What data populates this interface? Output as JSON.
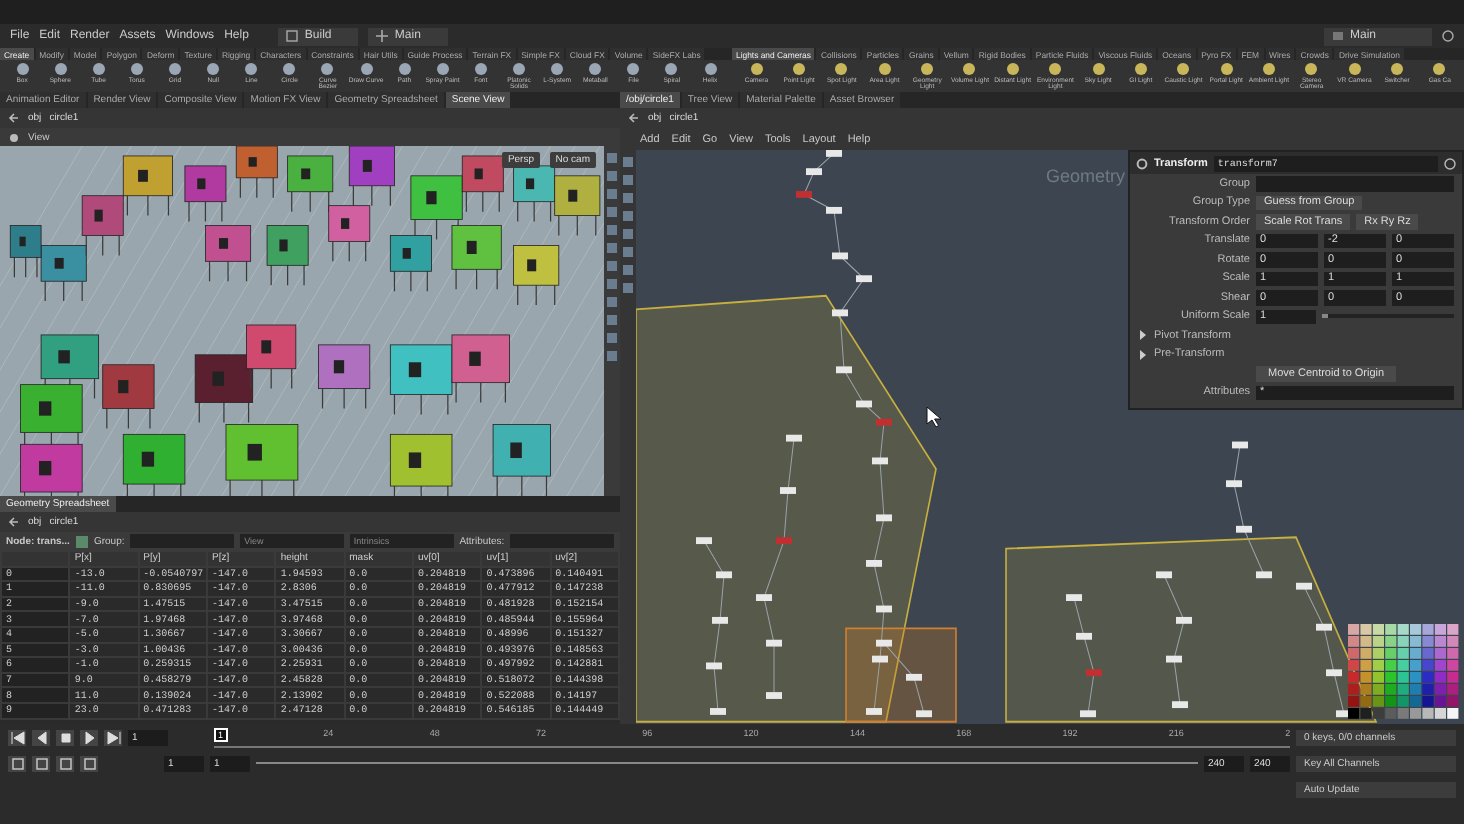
{
  "menubar": {
    "menus": [
      "File",
      "Edit",
      "Render",
      "Assets",
      "Windows",
      "Help"
    ],
    "desktop": "Build",
    "context": "Main",
    "right_context": "Main"
  },
  "shelves": [
    {
      "tabs": [
        {
          "label": "Create",
          "selected": true
        },
        {
          "label": "Modify",
          "selected": false
        },
        {
          "label": "Model",
          "selected": false
        },
        {
          "label": "Polygon",
          "selected": false
        },
        {
          "label": "Deform",
          "selected": false
        },
        {
          "label": "Texture",
          "selected": false
        },
        {
          "label": "Rigging",
          "selected": false
        },
        {
          "label": "Characters",
          "selected": false
        },
        {
          "label": "Constraints",
          "selected": false
        },
        {
          "label": "Hair Utils",
          "selected": false
        },
        {
          "label": "Guide Process",
          "selected": false
        },
        {
          "label": "Terrain FX",
          "selected": false
        },
        {
          "label": "Simple FX",
          "selected": false
        },
        {
          "label": "Cloud FX",
          "selected": false
        },
        {
          "label": "Volume",
          "selected": false
        },
        {
          "label": "SideFX Labs",
          "selected": false
        }
      ],
      "tools": [
        "Box",
        "Sphere",
        "Tube",
        "Torus",
        "Grid",
        "Null",
        "Line",
        "Circle",
        "Curve Bezier",
        "Draw Curve",
        "Path",
        "Spray Paint",
        "Font",
        "Platonic Solids",
        "L-System",
        "Metaball",
        "File",
        "Spiral",
        "Helix"
      ]
    },
    {
      "tabs": [
        {
          "label": "Lights and Cameras",
          "selected": true
        },
        {
          "label": "Collisions",
          "selected": false
        },
        {
          "label": "Particles",
          "selected": false
        },
        {
          "label": "Grains",
          "selected": false
        },
        {
          "label": "Vellum",
          "selected": false
        },
        {
          "label": "Rigid Bodies",
          "selected": false
        },
        {
          "label": "Particle Fluids",
          "selected": false
        },
        {
          "label": "Viscous Fluids",
          "selected": false
        },
        {
          "label": "Oceans",
          "selected": false
        },
        {
          "label": "Pyro FX",
          "selected": false
        },
        {
          "label": "FEM",
          "selected": false
        },
        {
          "label": "Wires",
          "selected": false
        },
        {
          "label": "Crowds",
          "selected": false
        },
        {
          "label": "Drive Simulation",
          "selected": false
        }
      ],
      "tools": [
        "Camera",
        "Point Light",
        "Spot Light",
        "Area Light",
        "Geometry Light",
        "Volume Light",
        "Distant Light",
        "Environment Light",
        "Sky Light",
        "GI Light",
        "Caustic Light",
        "Portal Light",
        "Ambient Light",
        "Stereo Camera",
        "VR Camera",
        "Switcher",
        "Gas Ca"
      ]
    }
  ],
  "scene_pane": {
    "tabs": [
      {
        "label": "Animation Editor",
        "selected": false
      },
      {
        "label": "Render View",
        "selected": false
      },
      {
        "label": "Composite View",
        "selected": false
      },
      {
        "label": "Motion FX View",
        "selected": false
      },
      {
        "label": "Geometry Spreadsheet",
        "selected": false
      },
      {
        "label": "Scene View",
        "selected": true
      }
    ],
    "path": [
      "obj",
      "circle1"
    ],
    "view_label": "View",
    "camera": "Persp",
    "cam_menu": "No cam"
  },
  "spreadsheet": {
    "tab": "Geometry Spreadsheet",
    "path": [
      "obj",
      "circle1"
    ],
    "node": "Node: trans...",
    "group_label": "Group:",
    "view": "View",
    "intrinsics": "Intrinsics",
    "attributes_label": "Attributes:",
    "columns": [
      "",
      "P[x]",
      "P[y]",
      "P[z]",
      "height",
      "mask",
      "uv[0]",
      "uv[1]",
      "uv[2]"
    ],
    "rows": [
      [
        "0",
        "-13.0",
        "-0.0540797",
        "-147.0",
        "1.94593",
        "0.0",
        "0.204819",
        "0.473896",
        "0.140491"
      ],
      [
        "1",
        "-11.0",
        "0.830695",
        "-147.0",
        "2.8306",
        "0.0",
        "0.204819",
        "0.477912",
        "0.147238"
      ],
      [
        "2",
        "-9.0",
        "1.47515",
        "-147.0",
        "3.47515",
        "0.0",
        "0.204819",
        "0.481928",
        "0.152154"
      ],
      [
        "3",
        "-7.0",
        "1.97468",
        "-147.0",
        "3.97468",
        "0.0",
        "0.204819",
        "0.485944",
        "0.155964"
      ],
      [
        "4",
        "-5.0",
        "1.30667",
        "-147.0",
        "3.30667",
        "0.0",
        "0.204819",
        "0.48996",
        "0.151327"
      ],
      [
        "5",
        "-3.0",
        "1.00436",
        "-147.0",
        "3.00436",
        "0.0",
        "0.204819",
        "0.493976",
        "0.148563"
      ],
      [
        "6",
        "-1.0",
        "0.259315",
        "-147.0",
        "2.25931",
        "0.0",
        "0.204819",
        "0.497992",
        "0.142881"
      ],
      [
        "7",
        "9.0",
        "0.458279",
        "-147.0",
        "2.45828",
        "0.0",
        "0.204819",
        "0.518072",
        "0.144398"
      ],
      [
        "8",
        "11.0",
        "0.139024",
        "-147.0",
        "2.13902",
        "0.0",
        "0.204819",
        "0.522088",
        "0.14197"
      ],
      [
        "9",
        "23.0",
        "0.471283",
        "-147.0",
        "2.47128",
        "0.0",
        "0.204819",
        "0.546185",
        "0.144449"
      ]
    ]
  },
  "network_pane": {
    "tabs": [
      {
        "label": "/obj/circle1",
        "selected": true
      },
      {
        "label": "Tree View",
        "selected": false
      },
      {
        "label": "Material Palette",
        "selected": false
      },
      {
        "label": "Asset Browser",
        "selected": false
      }
    ],
    "path": [
      "obj",
      "circle1"
    ],
    "menus": [
      "Add",
      "Edit",
      "Go",
      "View",
      "Tools",
      "Layout",
      "Help"
    ],
    "context_label": "Geometry"
  },
  "parameters": {
    "node_type": "Transform",
    "node_name": "transform7",
    "rows": [
      {
        "kind": "field",
        "label": "Group",
        "value": ""
      },
      {
        "kind": "menu",
        "label": "Group Type",
        "values": [
          "Guess from Group"
        ]
      },
      {
        "kind": "menu",
        "label": "Transform Order",
        "values": [
          "Scale Rot Trans",
          "Rx Ry Rz"
        ]
      },
      {
        "kind": "vector",
        "label": "Translate",
        "values": [
          "0",
          "-2",
          "0"
        ]
      },
      {
        "kind": "vector",
        "label": "Rotate",
        "values": [
          "0",
          "0",
          "0"
        ]
      },
      {
        "kind": "vector",
        "label": "Scale",
        "values": [
          "1",
          "1",
          "1"
        ]
      },
      {
        "kind": "vector",
        "label": "Shear",
        "values": [
          "0",
          "0",
          "0"
        ]
      },
      {
        "kind": "slider",
        "label": "Uniform Scale",
        "value": "1",
        "level": 0.05
      },
      {
        "kind": "folder",
        "label": "Pivot Transform",
        "expanded": false
      },
      {
        "kind": "folder",
        "label": "Pre-Transform",
        "expanded": false
      },
      {
        "kind": "button",
        "label": "Move Centroid to Origin"
      },
      {
        "kind": "field",
        "label": "Attributes",
        "value": "*"
      }
    ]
  },
  "timeline": {
    "frame": "1",
    "current_frame": "1",
    "ticks": [
      "24",
      "48",
      "72",
      "96",
      "120",
      "144",
      "168",
      "192",
      "216",
      "2"
    ],
    "start": [
      "1",
      "1"
    ],
    "end": [
      "240",
      "240"
    ],
    "keys": "0 keys, 0/0 channels",
    "key_all": "Key All Channels",
    "update": "Auto Update"
  }
}
